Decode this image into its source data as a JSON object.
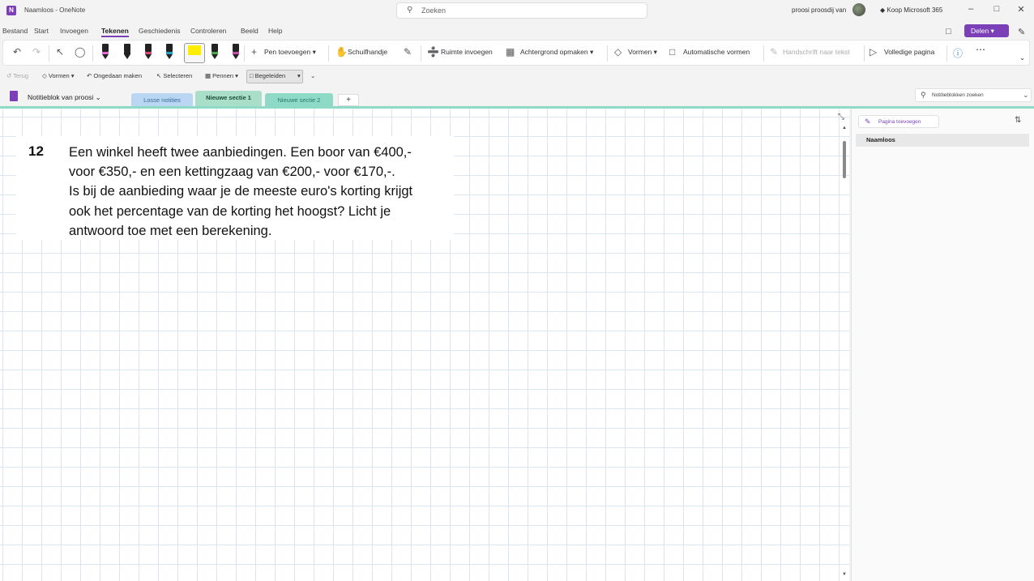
{
  "window": {
    "title": "Naamloos - OneNote",
    "user": "proosi proosdij van",
    "buy": "Koop Microsoft 365",
    "app_icon": "N"
  },
  "search": {
    "placeholder": "Zoeken"
  },
  "menu": [
    "Bestand",
    "Start",
    "Invoegen",
    "Tekenen",
    "Geschiedenis",
    "Controleren",
    "Beeld",
    "Help"
  ],
  "menu_active": "Tekenen",
  "share": {
    "label": "Delen"
  },
  "ribbon": {
    "add_pen": "Pen toevoegen",
    "hand": "Schuifhandje",
    "insert_space": "Ruimte invoegen",
    "background": "Achtergrond opmaken",
    "shapes": "Vormen",
    "auto_shapes": "Automatische vormen",
    "ink_to_text": "Handschrift naar tekst",
    "full_page": "Volledige pagina"
  },
  "pens": [
    {
      "color": "#222222",
      "band": "#e06ad0"
    },
    {
      "color": "#222222",
      "band": "#222222"
    },
    {
      "color": "#222222",
      "band": "#d24a6e"
    },
    {
      "color": "#222222",
      "band": "#1fa0c8"
    },
    {
      "color": "#222222",
      "band": "#ffee00"
    },
    {
      "color": "#222222",
      "band": "#4aa84a"
    },
    {
      "color": "#222222",
      "band": "#c84aa8"
    }
  ],
  "toolbar2": {
    "back": "Terug",
    "shapes": "Vormen",
    "undo": "Ongedaan maken",
    "select": "Selecteren",
    "pens": "Pennen",
    "ruler": "Begeleiden"
  },
  "notebook": {
    "name": "Notitieblok van proosi"
  },
  "sections": [
    {
      "label": "Losse notities",
      "bg": "#b9d7f3",
      "color": "#3a6a9a"
    },
    {
      "label": "Nieuwe sectie 1",
      "bg": "#a9dfc9",
      "color": "#1a4a38"
    },
    {
      "label": "Nieuwe sectie 2",
      "bg": "#8fd9c7",
      "color": "#2a7a68"
    }
  ],
  "notebook_search": {
    "placeholder": "Notitieblokken zoeken"
  },
  "note": {
    "number": "12",
    "lines": [
      "Een winkel heeft twee aanbiedingen. Een boor van €400,-",
      "voor €350,- en een kettingzaag van €200,- voor €170,-.",
      "Is bij de aanbieding waar je de meeste euro's korting krijgt",
      "ook het percentage van de korting het hoogst? Licht je",
      "antwoord toe met een berekening."
    ]
  },
  "pages": {
    "add_label": "Pagina toevoegen",
    "items": [
      "Naamloos"
    ]
  }
}
